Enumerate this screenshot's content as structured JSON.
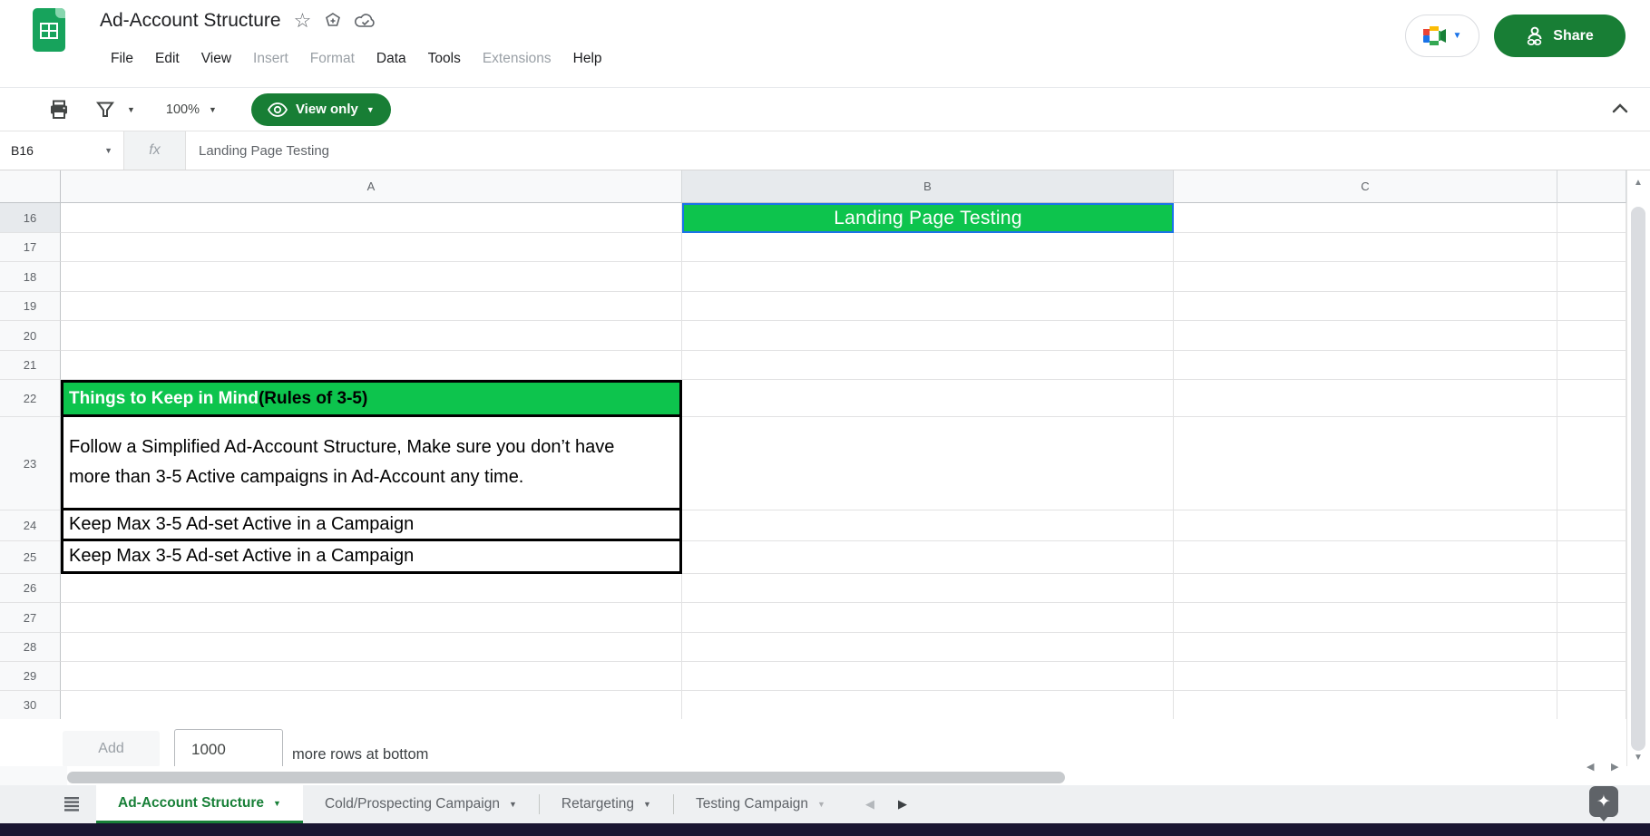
{
  "header": {
    "title": "Ad-Account Structure",
    "star_icon": "☆",
    "menu": [
      {
        "label": "File",
        "enabled": true
      },
      {
        "label": "Edit",
        "enabled": true
      },
      {
        "label": "View",
        "enabled": true
      },
      {
        "label": "Insert",
        "enabled": false
      },
      {
        "label": "Format",
        "enabled": false
      },
      {
        "label": "Data",
        "enabled": true
      },
      {
        "label": "Tools",
        "enabled": true
      },
      {
        "label": "Extensions",
        "enabled": false
      },
      {
        "label": "Help",
        "enabled": true
      }
    ],
    "share_label": "Share"
  },
  "toolbar": {
    "zoom_value": "100%",
    "view_only_label": "View only"
  },
  "formula_bar": {
    "cell_ref": "B16",
    "fx_label": "fx",
    "formula_text": "Landing Page Testing"
  },
  "grid": {
    "column_headers": [
      "A",
      "B",
      "C"
    ],
    "selected_column": "B",
    "selected_row": 16,
    "row_numbers": [
      16,
      17,
      18,
      19,
      20,
      21,
      22,
      23,
      24,
      25,
      26,
      27,
      28,
      29,
      30
    ],
    "cells": [
      {
        "ref": "B16",
        "style": "selected-title",
        "text": "Landing Page Testing"
      },
      {
        "ref": "A22",
        "style": "green-heading",
        "rich": [
          {
            "text": "Things to Keep in Mind ",
            "color": "#ffffff"
          },
          {
            "text": "(Rules of 3-5)",
            "color": "#000000"
          }
        ]
      },
      {
        "ref": "A23",
        "style": "note",
        "text": "Follow a Simplified Ad-Account Structure, Make sure you don’t have more than 3-5 Active campaigns in Ad-Account any time."
      },
      {
        "ref": "A24",
        "style": "note",
        "text": "Keep Max 3-5 Ad-set Active in a Campaign"
      },
      {
        "ref": "A25",
        "style": "note",
        "text": "Keep Max 3-5 Ad-set Active in a Campaign"
      }
    ]
  },
  "add_bar": {
    "add_label": "Add",
    "rows_value": "1000",
    "suffix_label": "more rows at bottom"
  },
  "sheet_tabs": [
    {
      "label": "Ad-Account Structure",
      "active": true
    },
    {
      "label": "Cold/Prospecting Campaign",
      "active": false
    },
    {
      "label": "Retargeting",
      "active": false
    },
    {
      "label": "Testing Campaign",
      "active": false
    }
  ],
  "glyphs": {
    "caret_down": "▼",
    "nav_left": "◀",
    "nav_right": "▶",
    "sparkle": "✦",
    "scroll_up": "▲",
    "scroll_down": "▼"
  },
  "colors": {
    "cell_green": "#0dc44d",
    "selection_blue": "#1a73e8",
    "button_green": "#187e35",
    "active_tab_green": "#188038",
    "disabled_menu_text": "#9aa0a6"
  }
}
